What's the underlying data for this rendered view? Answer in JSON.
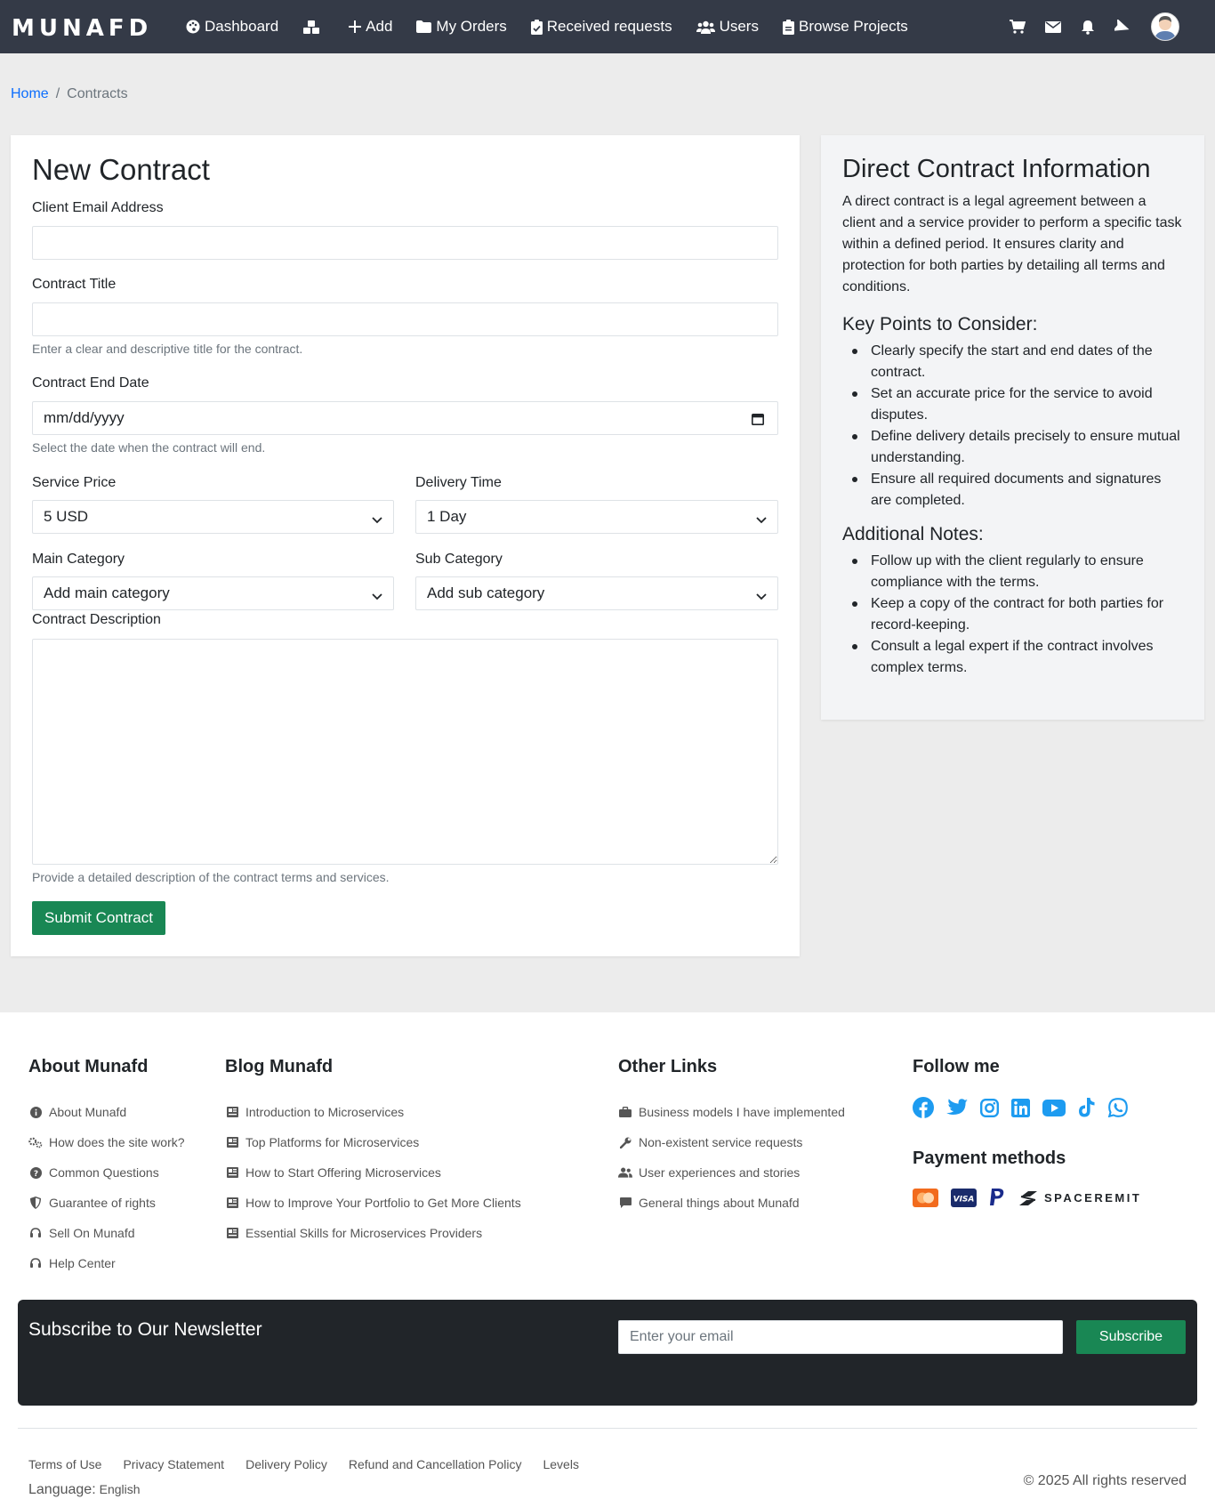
{
  "nav": {
    "brand": "MUNAFD",
    "items": [
      {
        "label": "Dashboard",
        "icon": "palette-icon"
      },
      {
        "label": "",
        "icon": "boxes-icon"
      },
      {
        "label": "Add",
        "icon": "plus-icon"
      },
      {
        "label": "My Orders",
        "icon": "folder-icon"
      },
      {
        "label": "Received requests",
        "icon": "clipboard-check-icon"
      },
      {
        "label": "Users",
        "icon": "users-icon"
      },
      {
        "label": "Browse Projects",
        "icon": "clipboard-icon"
      }
    ],
    "right_icons": [
      "cart-icon",
      "envelope-icon",
      "bell-icon",
      "paper-plane-icon",
      "avatar"
    ]
  },
  "breadcrumb": {
    "home": "Home",
    "current": "Contracts"
  },
  "form": {
    "title": "New Contract",
    "client_email_label": "Client Email Address",
    "contract_title_label": "Contract Title",
    "contract_title_help": "Enter a clear and descriptive title for the contract.",
    "end_date_label": "Contract End Date",
    "end_date_placeholder": "mm/dd/yyyy",
    "end_date_help": "Select the date when the contract will end.",
    "service_price_label": "Service Price",
    "service_price_value": "5 USD",
    "delivery_time_label": "Delivery Time",
    "delivery_time_value": "1 Day",
    "main_category_label": "Main Category",
    "main_category_value": "Add main category",
    "sub_category_label": "Sub Category",
    "sub_category_value": "Add sub category",
    "description_label": "Contract Description",
    "description_help": "Provide a detailed description of the contract terms and services.",
    "submit_label": "Submit Contract"
  },
  "info": {
    "title": "Direct Contract Information",
    "intro": "A direct contract is a legal agreement between a client and a service provider to perform a specific task within a defined period. It ensures clarity and protection for both parties by detailing all terms and conditions.",
    "key_points_title": "Key Points to Consider:",
    "key_points": [
      "Clearly specify the start and end dates of the contract.",
      "Set an accurate price for the service to avoid disputes.",
      "Define delivery details precisely to ensure mutual understanding.",
      "Ensure all required documents and signatures are completed."
    ],
    "notes_title": "Additional Notes:",
    "notes": [
      "Follow up with the client regularly to ensure compliance with the terms.",
      "Keep a copy of the contract for both parties for record-keeping.",
      "Consult a legal expert if the contract involves complex terms."
    ]
  },
  "footer": {
    "about": {
      "title": "About Munafd",
      "links": [
        {
          "label": "About Munafd",
          "icon": "info-circle-icon"
        },
        {
          "label": "How does the site work?",
          "icon": "cogs-icon"
        },
        {
          "label": "Common Questions",
          "icon": "question-circle-icon"
        },
        {
          "label": "Guarantee of rights",
          "icon": "shield-icon"
        },
        {
          "label": "Sell On Munafd",
          "icon": "headset-icon"
        },
        {
          "label": "Help Center",
          "icon": "headset-icon"
        }
      ]
    },
    "blog": {
      "title": "Blog Munafd",
      "links": [
        "Introduction to Microservices",
        "Top Platforms for Microservices",
        "How to Start Offering Microservices",
        "How to Improve Your Portfolio to Get More Clients",
        "Essential Skills for Microservices Providers"
      ]
    },
    "other": {
      "title": "Other Links",
      "links": [
        {
          "label": "Business models I have implemented",
          "icon": "briefcase-icon"
        },
        {
          "label": "Non-existent service requests",
          "icon": "wrench-icon"
        },
        {
          "label": "User experiences and stories",
          "icon": "users-icon"
        },
        {
          "label": "General things about Munafd",
          "icon": "comment-icon"
        }
      ]
    },
    "follow": {
      "title": "Follow me",
      "social": [
        "facebook-icon",
        "twitter-icon",
        "instagram-icon",
        "linkedin-icon",
        "youtube-icon",
        "tiktok-icon",
        "whatsapp-icon"
      ],
      "payment_title": "Payment methods",
      "payment_methods": [
        "mastercard-icon",
        "visa-icon",
        "paypal-icon",
        "spaceremit-logo"
      ],
      "spaceremit_text": "SPACEREMIT"
    },
    "newsletter": {
      "title": "Subscribe to Our Newsletter",
      "placeholder": "Enter your email",
      "button": "Subscribe"
    },
    "legal_links": [
      "Terms of Use",
      "Privacy Statement",
      "Delivery Policy",
      "Refund and Cancellation Policy",
      "Levels"
    ],
    "language_label": "Language:",
    "language_value": "English",
    "copyright": "© 2025 All rights reserved"
  },
  "colors": {
    "navbar": "#343a47",
    "primary_link": "#0d6efd",
    "success": "#198754",
    "social": "#1d9bf0",
    "newsletter_bg": "#212529"
  }
}
